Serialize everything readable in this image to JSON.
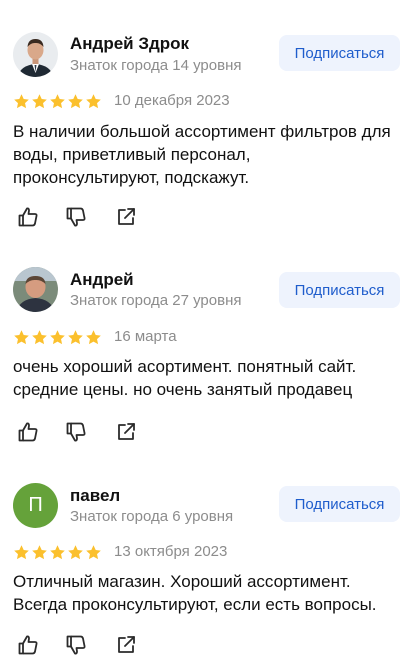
{
  "reviews": [
    {
      "author": "Андрей Здрок",
      "level": "Знаток города 14 уровня",
      "subscribe_label": "Подписаться",
      "rating": 5,
      "date": "10 декабря 2023",
      "text": "В наличии большой ассортимент фильтров для воды, приветливый персонал, проконсультируют, подскажут.",
      "avatar": "photo-man-in-suit"
    },
    {
      "author": "Андрей",
      "level": "Знаток города 27 уровня",
      "subscribe_label": "Подписаться",
      "rating": 5,
      "date": "16 марта",
      "text": "очень хороший асортимент. понятный сайт. средние цены. но очень занятый продавец",
      "avatar": "photo-man-outdoors"
    },
    {
      "author": "павел",
      "level": "Знаток города 6 уровня",
      "subscribe_label": "Подписаться",
      "rating": 5,
      "date": "13 октября 2023",
      "text": "Отличный магазин. Хороший ассортимент. Всегда проконсультируют, если есть вопросы.",
      "avatar_letter": "П",
      "avatar_color": "#65a23a"
    }
  ],
  "colors": {
    "star": "#fbc02d",
    "subscribe_bg": "#eef3fd",
    "subscribe_text": "#1f5dcc",
    "muted": "#8c8c8c"
  },
  "icons": {
    "like": "thumbs-up-icon",
    "dislike": "thumbs-down-icon",
    "share": "share-icon"
  }
}
